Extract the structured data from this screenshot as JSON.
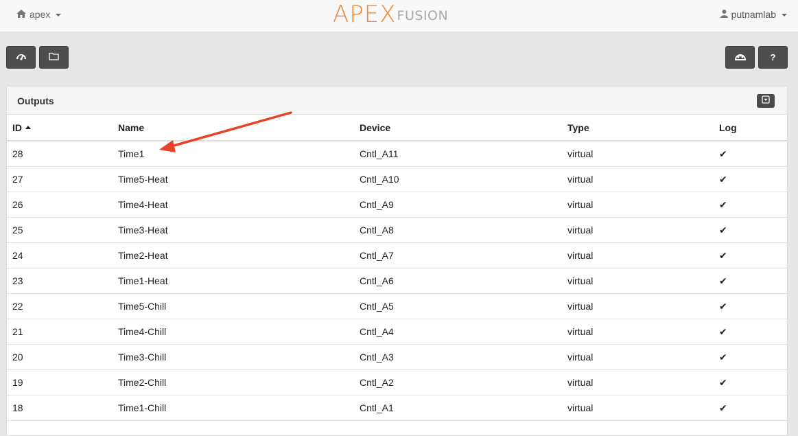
{
  "nav": {
    "site_label": "apex",
    "user_label": "putnamlab",
    "logo_apex": "APEX",
    "logo_fusion": "FUSION"
  },
  "toolbar": {
    "buttons_left": [
      "dashboard-icon",
      "folder-icon"
    ],
    "buttons_right": [
      "apex-controller-icon",
      "help"
    ],
    "help_label": "?"
  },
  "panel": {
    "title": "Outputs",
    "columns": [
      "ID",
      "Name",
      "Device",
      "Type",
      "Log"
    ],
    "sort": {
      "column": "ID",
      "direction": "ascending-indicator"
    },
    "rows": [
      {
        "id": "28",
        "name": "Time1",
        "device": "Cntl_A11",
        "type": "virtual",
        "log": "✔"
      },
      {
        "id": "27",
        "name": "Time5-Heat",
        "device": "Cntl_A10",
        "type": "virtual",
        "log": "✔"
      },
      {
        "id": "26",
        "name": "Time4-Heat",
        "device": "Cntl_A9",
        "type": "virtual",
        "log": "✔"
      },
      {
        "id": "25",
        "name": "Time3-Heat",
        "device": "Cntl_A8",
        "type": "virtual",
        "log": "✔"
      },
      {
        "id": "24",
        "name": "Time2-Heat",
        "device": "Cntl_A7",
        "type": "virtual",
        "log": "✔"
      },
      {
        "id": "23",
        "name": "Time1-Heat",
        "device": "Cntl_A6",
        "type": "virtual",
        "log": "✔"
      },
      {
        "id": "22",
        "name": "Time5-Chill",
        "device": "Cntl_A5",
        "type": "virtual",
        "log": "✔"
      },
      {
        "id": "21",
        "name": "Time4-Chill",
        "device": "Cntl_A4",
        "type": "virtual",
        "log": "✔"
      },
      {
        "id": "20",
        "name": "Time3-Chill",
        "device": "Cntl_A3",
        "type": "virtual",
        "log": "✔"
      },
      {
        "id": "19",
        "name": "Time2-Chill",
        "device": "Cntl_A2",
        "type": "virtual",
        "log": "✔"
      },
      {
        "id": "18",
        "name": "Time1-Chill",
        "device": "Cntl_A1",
        "type": "virtual",
        "log": "✔"
      }
    ]
  },
  "annotation": {
    "color": "#e8432a",
    "points_to_row_id": "28"
  },
  "colors": {
    "logo_orange": "#f0883a",
    "button_dark": "#4e4e4e",
    "arrow_red": "#e8432a"
  }
}
